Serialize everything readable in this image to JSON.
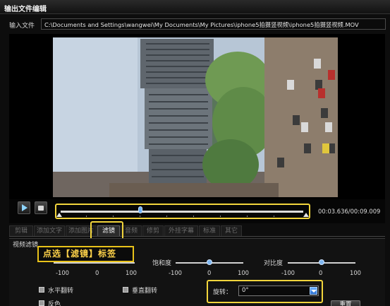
{
  "window": {
    "title": "输出文件编辑"
  },
  "input": {
    "label": "输入文件",
    "path": "C:\\Documents and Settings\\wangwei\\My Documents\\My Pictures\\iphone5拍摄竖视频\\iphone5拍摄竖视频.MOV"
  },
  "player": {
    "time": "00:03.636/00:09.009",
    "progress_fraction": 0.34
  },
  "tabs": [
    {
      "label": "剪辑",
      "active": false
    },
    {
      "label": "添加文字",
      "active": false
    },
    {
      "label": "添加图片",
      "active": false
    },
    {
      "label": "滤镜",
      "active": true
    },
    {
      "label": "音频",
      "active": false
    },
    {
      "label": "修剪",
      "active": false
    },
    {
      "label": "外挂字幕",
      "active": false
    },
    {
      "label": "标准",
      "active": false
    },
    {
      "label": "其它",
      "active": false
    }
  ],
  "filter_panel": {
    "title": "视频滤镜",
    "callout": "点选【滤镜】标签",
    "brightness": {
      "min": "-100",
      "mid": "0",
      "max": "100",
      "value": 0
    },
    "saturation": {
      "label": "饱和度",
      "min": "-100",
      "mid": "0",
      "max": "100",
      "value": 0
    },
    "contrast": {
      "label": "对比度",
      "min": "-100",
      "mid": "0",
      "max": "100",
      "value": 0
    },
    "flip_horizontal": "水平翻转",
    "flip_vertical": "垂直翻转",
    "invert": "反色",
    "rotate": {
      "label": "旋转：",
      "value": "0°"
    },
    "reset": "重置"
  },
  "colors": {
    "highlight": "#f2d53c",
    "callout_text": "#ffd34a"
  }
}
